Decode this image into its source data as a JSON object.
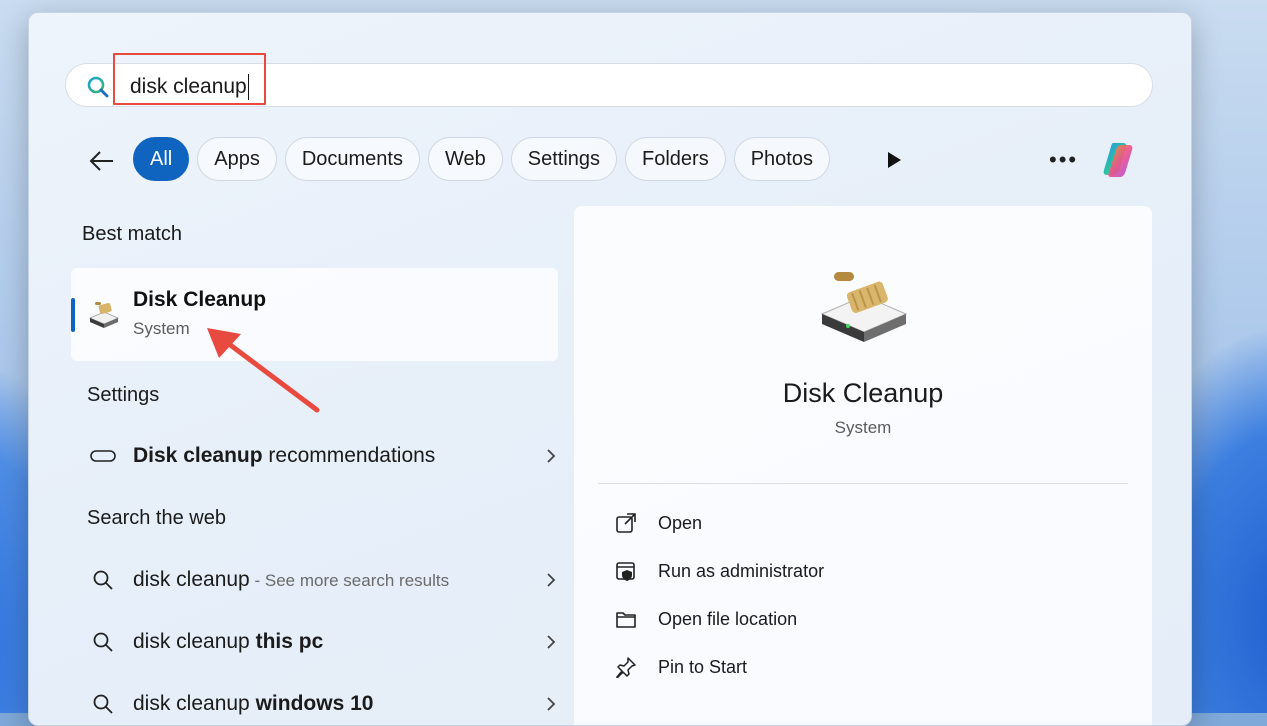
{
  "search": {
    "query": "disk cleanup"
  },
  "filters": {
    "chips": [
      "All",
      "Apps",
      "Documents",
      "Web",
      "Settings",
      "Folders",
      "Photos"
    ],
    "active": "All"
  },
  "best_match": {
    "heading": "Best match",
    "title": "Disk Cleanup",
    "subtitle": "System"
  },
  "settings_section": {
    "heading": "Settings",
    "item_bold": "Disk cleanup",
    "item_rest": " recommendations"
  },
  "web_section": {
    "heading": "Search the web",
    "items": [
      {
        "main": "disk cleanup",
        "bold": "",
        "extra": " - See more search results"
      },
      {
        "main": "disk cleanup ",
        "bold": "this pc",
        "extra": ""
      },
      {
        "main": "disk cleanup ",
        "bold": "windows 10",
        "extra": ""
      }
    ]
  },
  "preview": {
    "title": "Disk Cleanup",
    "subtitle": "System",
    "actions": [
      "Open",
      "Run as administrator",
      "Open file location",
      "Pin to Start"
    ]
  },
  "colors": {
    "accent": "#0f64c0",
    "highlight": "#e84a3f"
  }
}
